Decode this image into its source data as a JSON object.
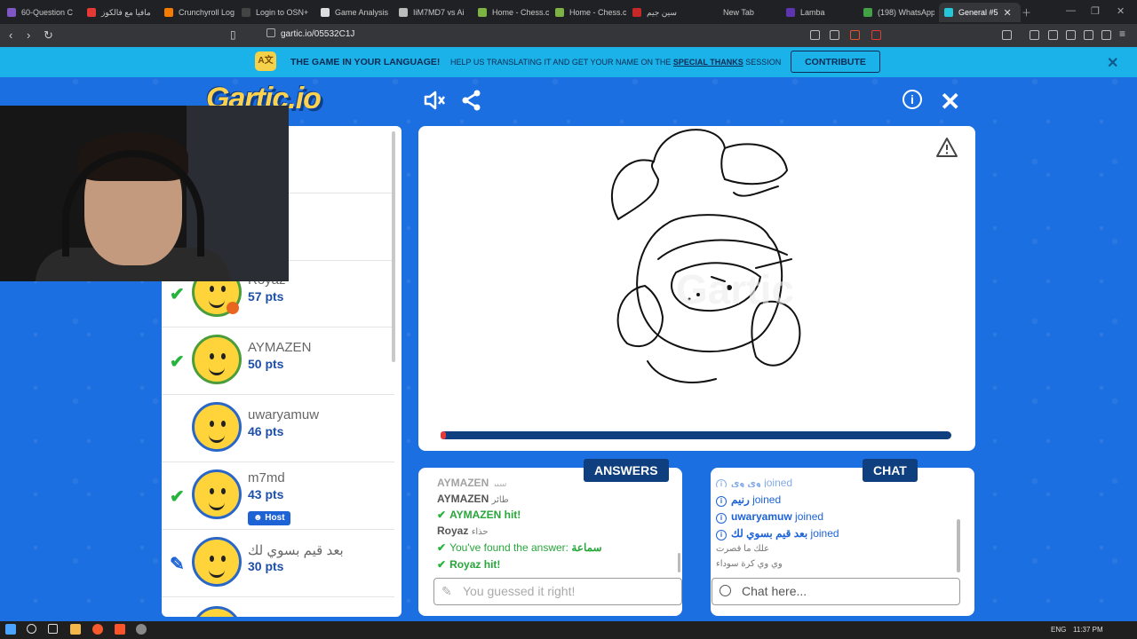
{
  "browser": {
    "tabs": [
      {
        "label": "60-Question C",
        "color": "#7e57c2"
      },
      {
        "label": "مافيا مع فالكوز",
        "color": "#e53935"
      },
      {
        "label": "Crunchyroll Log",
        "color": "#f57c00"
      },
      {
        "label": "Login to OSN+",
        "color": "#444444"
      },
      {
        "label": "Game Analysis",
        "color": "#dddddd"
      },
      {
        "label": "IiM7MD7 vs Ai",
        "color": "#bbbbbb"
      },
      {
        "label": "Home - Chess.c",
        "color": "#7cb342"
      },
      {
        "label": "Home - Chess.c",
        "color": "#7cb342"
      },
      {
        "label": "سين جيم",
        "color": "#c62828"
      },
      {
        "label": "New Tab",
        "color": "#202124"
      },
      {
        "label": "Lamba",
        "color": "#5e35b1"
      },
      {
        "label": "(198) WhatsApp",
        "color": "#43a047"
      },
      {
        "label": "General #5",
        "color": "#26c6da"
      }
    ],
    "url": "gartic.io/05532C1J"
  },
  "banner": {
    "headline": "THE GAME IN YOUR LANGUAGE!",
    "text": "HELP US TRANSLATING IT AND GET YOUR NAME ON THE",
    "link": "SPECIAL THANKS",
    "text_end": "SESSION",
    "button": "CONTRIBUTE"
  },
  "game": {
    "logo": "Gartic.io",
    "players": [
      {
        "name": "Royaz",
        "pts": "57 pts",
        "status": "hit",
        "dot": true
      },
      {
        "name": "AYMAZEN",
        "pts": "50 pts",
        "status": "hit",
        "dot": false
      },
      {
        "name": "uwaryamuw",
        "pts": "46 pts",
        "status": "none",
        "dot": false
      },
      {
        "name": "m7md",
        "pts": "43 pts",
        "status": "hit",
        "host": "Host",
        "dot": false
      },
      {
        "name": "بعد قيم بسوي لك",
        "pts": "30 pts",
        "status": "drawing",
        "dot": false
      }
    ],
    "timer_remaining_fraction": 0.01
  },
  "answers": {
    "title": "ANSWERS",
    "messages": [
      {
        "type": "guess",
        "name": "AYMAZEN",
        "text": "سير"
      },
      {
        "type": "guess",
        "name": "AYMAZEN",
        "text": "طائر"
      },
      {
        "type": "hit",
        "name": "AYMAZEN",
        "text": "hit!"
      },
      {
        "type": "guess",
        "name": "Royaz",
        "text": "حذاء"
      },
      {
        "type": "found",
        "text": "You've found the answer:",
        "answer": "سماعة"
      },
      {
        "type": "hit",
        "name": "Royaz",
        "text": "hit!"
      }
    ],
    "input_placeholder": "You guessed it right!"
  },
  "chat": {
    "title": "CHAT",
    "messages": [
      {
        "type": "join",
        "name": "وي وي",
        "text": "joined"
      },
      {
        "type": "join",
        "name": "رنيم",
        "text": "joined"
      },
      {
        "type": "join",
        "name": "uwaryamuw",
        "text": "joined"
      },
      {
        "type": "join",
        "name": "بعد قيم بسوي لك",
        "text": "joined"
      },
      {
        "type": "plain",
        "text": "علك ما قصرت"
      },
      {
        "type": "plain",
        "text": "وي وي كرة سوداء"
      }
    ],
    "input_placeholder": "Chat here..."
  },
  "taskbar": {
    "lang": "ENG",
    "time": "11:37 PM"
  }
}
